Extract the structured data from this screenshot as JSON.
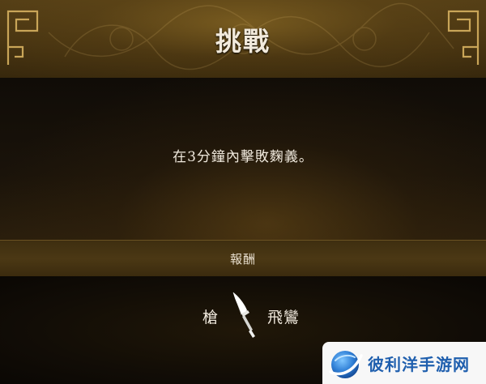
{
  "challenge": {
    "title": "挑戰",
    "description": "在3分鐘內擊敗麴義。"
  },
  "reward": {
    "section_label": "報酬",
    "item_type": "槍",
    "item_icon": "spear-icon",
    "item_name": "飛鸞"
  },
  "watermark": {
    "text": "彼利洋手游网",
    "logo_icon": "globe-swoosh-logo"
  },
  "colors": {
    "banner": "#4a3612",
    "text": "#f2eadc",
    "watermark_text": "#1f5fae"
  }
}
